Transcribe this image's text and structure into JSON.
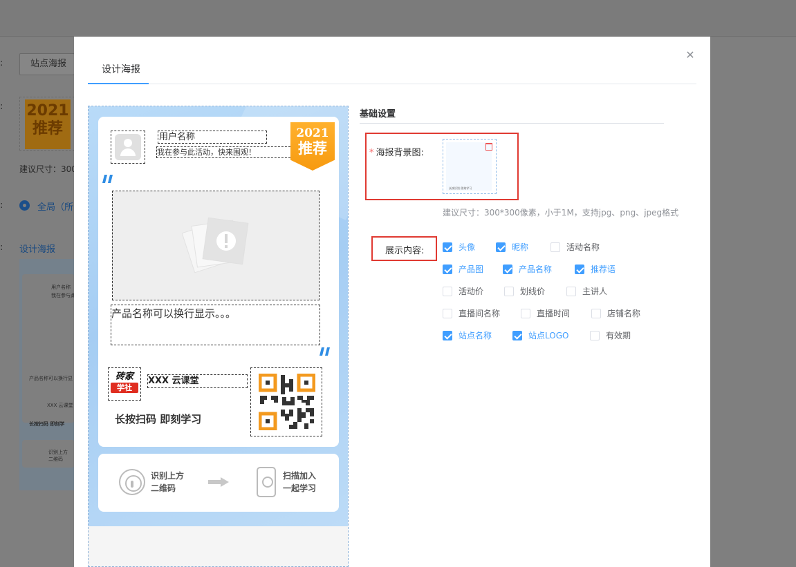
{
  "background": {
    "select_value": "站点海报",
    "size_hint": "建议尺寸：300",
    "radio_label": "全局（所",
    "design_link": "设计海报",
    "thumb_badge": {
      "year": "2021",
      "text": "推荐"
    },
    "preview": {
      "name": "用户名称",
      "invite": "我在参与此活动",
      "product": "产品名称可以换行显",
      "site": "XXX 云课堂",
      "scan": "长按扫码 即刻学",
      "step1a": "识别上方",
      "step1b": "二维码"
    }
  },
  "modal": {
    "tab": "设计海报",
    "close_glyph": "✕"
  },
  "poster": {
    "username": "用户名称",
    "invite": "我在参与此活动，快来围观！",
    "badge_year": "2021",
    "badge_text": "推荐",
    "quote_open": "❞",
    "quote_close": "❞",
    "product_name": "产品名称可以换行显示。。。",
    "logo_line1": "砖家",
    "logo_line2": "学社",
    "site_name": "XXX 云课堂",
    "scan_text": "长按扫码 即刻学习",
    "step1_a": "识别上方",
    "step1_b": "二维码",
    "step2_a": "扫描加入",
    "step2_b": "一起学习",
    "accent_color": "#2f8de4",
    "badge_color": "#f79a0f"
  },
  "settings": {
    "section_title": "基础设置",
    "bg_label": "海报背景图:",
    "upload_thumb_caption": "长按识别 即刻学习",
    "hint": "建议尺寸：300*300像素，小于1M，支持jpg、png、jpeg格式",
    "show_label": "展示内容:",
    "options": [
      {
        "label": "头像",
        "checked": true
      },
      {
        "label": "昵称",
        "checked": true
      },
      {
        "label": "活动名称",
        "checked": false
      },
      {
        "label": "产品图",
        "checked": true
      },
      {
        "label": "产品名称",
        "checked": true
      },
      {
        "label": "推荐语",
        "checked": true
      },
      {
        "label": "活动价",
        "checked": false
      },
      {
        "label": "划线价",
        "checked": false
      },
      {
        "label": "主讲人",
        "checked": false
      },
      {
        "label": "直播间名称",
        "checked": false
      },
      {
        "label": "直播时间",
        "checked": false
      },
      {
        "label": "店铺名称",
        "checked": false
      },
      {
        "label": "站点名称",
        "checked": true
      },
      {
        "label": "站点LOGO",
        "checked": true
      },
      {
        "label": "有效期",
        "checked": false
      }
    ],
    "primary_color": "#409eff",
    "highlight_color": "#e03a32"
  }
}
